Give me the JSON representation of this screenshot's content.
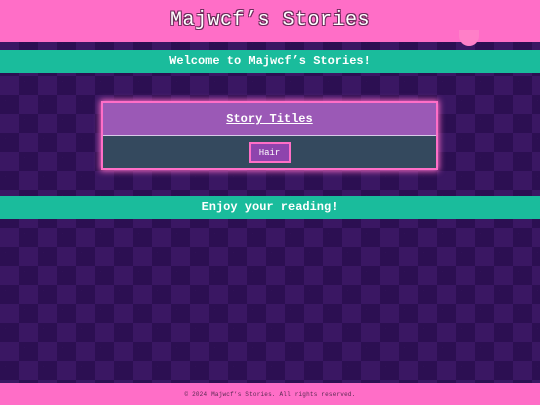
{
  "header": {
    "title": "Majwcf’s Stories"
  },
  "welcome": {
    "text": "Welcome to Majwcf’s Stories!"
  },
  "stories": {
    "title": "Story Titles",
    "items": [
      {
        "label": "Hair"
      }
    ]
  },
  "enjoy": {
    "text": "Enjoy your reading!"
  },
  "footer": {
    "text": "© 2024 Majwcf’s Stories. All rights reserved."
  },
  "colors": {
    "header_pink": "#ff6ec7",
    "band_teal": "#1abc9c",
    "card_purple": "#9b59b6",
    "card_body": "#34495e",
    "button_purple": "#8e44ad",
    "background_purple": "#3a1763"
  }
}
